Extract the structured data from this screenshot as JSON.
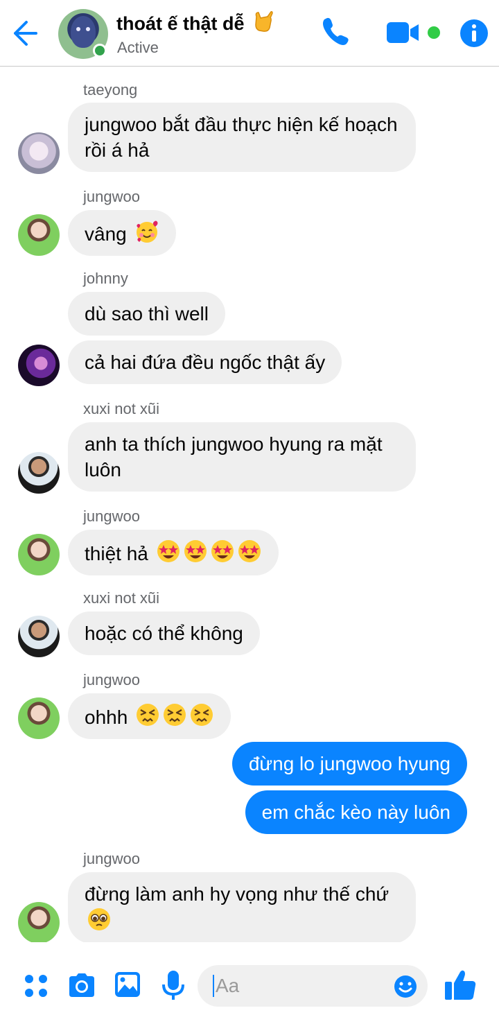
{
  "header": {
    "group_title": "thoát ế thật dễ",
    "status": "Active",
    "title_emoji": "🤙"
  },
  "colors": {
    "accent": "#0a84ff",
    "online": "#31cc46",
    "incoming_bubble": "#efefef",
    "outgoing_bubble": "#0a84ff"
  },
  "messages": [
    {
      "sender": "taeyong",
      "text": "jungwoo bắt đầu thực hiện kế hoạch rồi á hả"
    },
    {
      "sender": "jungwoo",
      "text": "vâng"
    },
    {
      "sender": "johnny",
      "text": "dù sao thì well"
    },
    {
      "text": "cả hai đứa đều ngốc thật ấy"
    },
    {
      "sender": "xuxi not xũi",
      "text": "anh ta thích jungwoo hyung ra mặt luôn"
    },
    {
      "sender": "jungwoo",
      "text": "thiệt hả"
    },
    {
      "sender": "xuxi not xũi",
      "text": "hoặc có thể không"
    },
    {
      "sender": "jungwoo",
      "text": "ohhh"
    },
    {
      "outgoing": true,
      "text": "đừng lo jungwoo hyung"
    },
    {
      "outgoing": true,
      "text": "em chắc kèo này luôn"
    },
    {
      "sender": "jungwoo",
      "text": "đừng làm anh hy vọng như thế chứ"
    }
  ],
  "composer": {
    "placeholder": "Aa"
  },
  "icons": [
    "back-arrow-icon",
    "phone-icon",
    "video-camera-icon",
    "info-icon",
    "apps-grid-icon",
    "camera-icon",
    "gallery-icon",
    "microphone-icon",
    "smile-icon",
    "thumbs-up-icon"
  ]
}
